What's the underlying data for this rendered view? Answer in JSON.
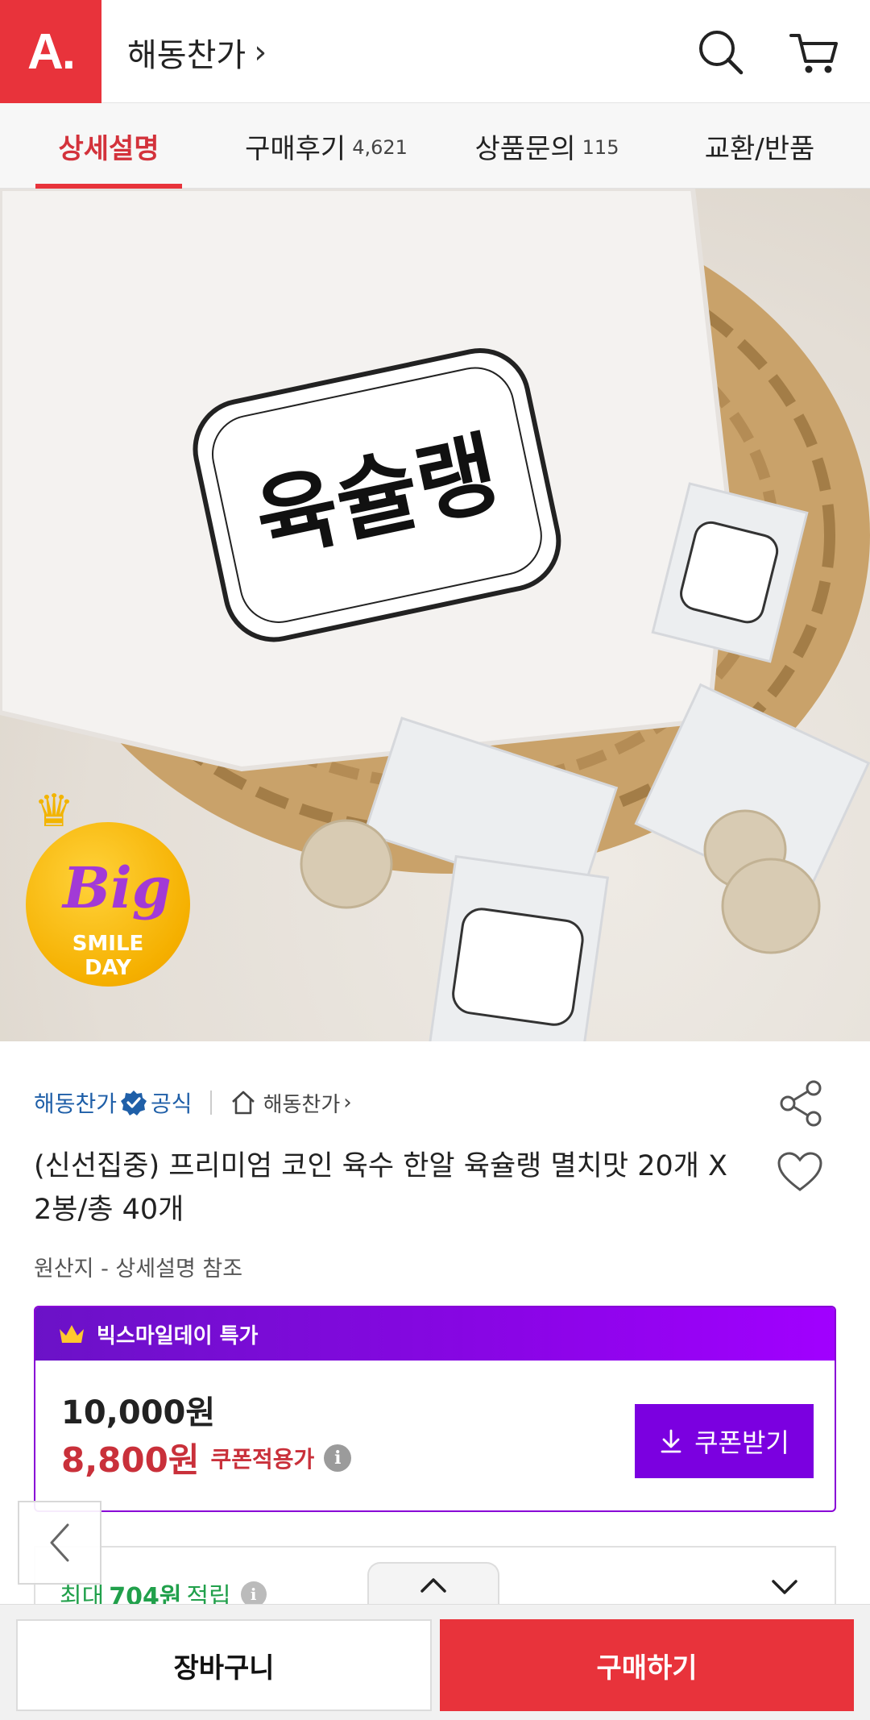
{
  "header": {
    "logo_text": "A.",
    "store_title": "해동찬가",
    "chevron": "›",
    "icons": [
      "search-icon",
      "cart-icon"
    ]
  },
  "tabs": [
    {
      "label": "상세설명",
      "count": ""
    },
    {
      "label": "구매후기",
      "count": "4,621"
    },
    {
      "label": "상품문의",
      "count": "115"
    },
    {
      "label": "교환/반품",
      "count": ""
    }
  ],
  "hero": {
    "badge_big": "Big",
    "badge_smile": "SMILE",
    "badge_day": "DAY",
    "bag_brand": "육슐랭",
    "colors": {
      "bag": "#f4f2f0",
      "basket": "#c9a26a",
      "tablet": "#d8cbb3"
    }
  },
  "store": {
    "name": "해동찬가",
    "official": "공식",
    "link": "해동찬가",
    "link_chevron": "›"
  },
  "product": {
    "title": "(신선집중) 프리미엄 코인 육수 한알 육슐랭 멸치맛 20개 X 2봉/총 40개",
    "origin": "원산지 - 상세설명 참조"
  },
  "price": {
    "promo_label": "빅스마일데이 특가",
    "original": "10,000원",
    "sale": "8,800원",
    "sale_label": "쿠폰적용가",
    "coupon_button": "쿠폰받기"
  },
  "reward": {
    "prefix": "최대",
    "amount": "704원",
    "suffix": "적립"
  },
  "bottom_bar": {
    "cart_label": "장바구니",
    "buy_label": "구매하기"
  },
  "colors": {
    "brand_red": "#e8333b",
    "promo_purple": "#7b00e0",
    "store_blue": "#1f5fa8",
    "reward_green": "#21a04b"
  }
}
